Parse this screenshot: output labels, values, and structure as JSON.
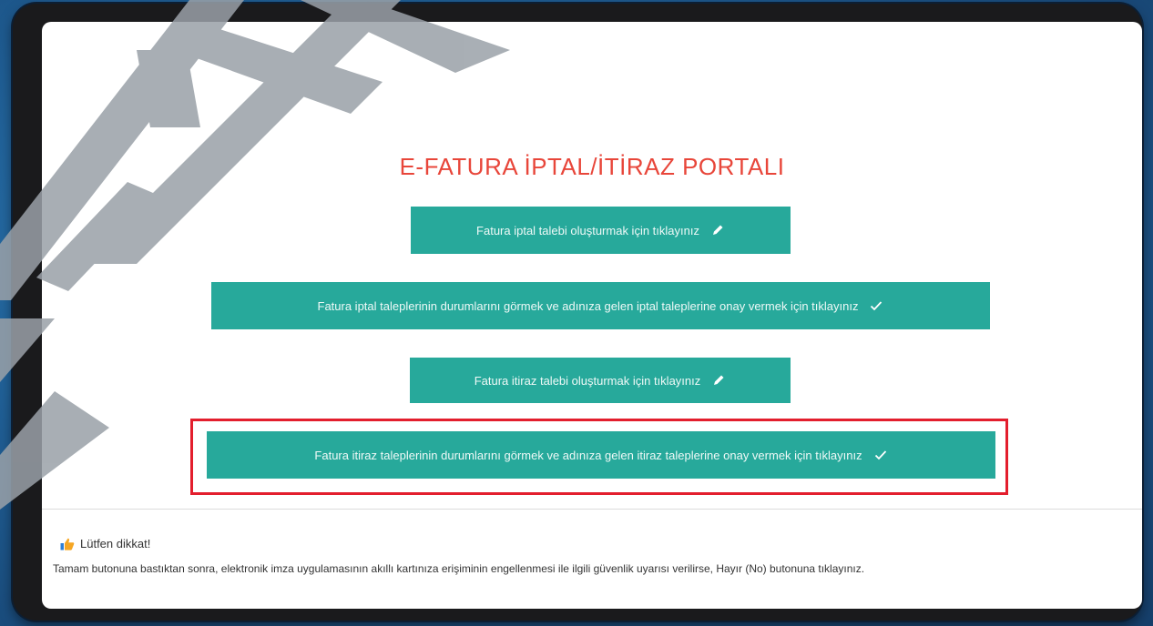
{
  "portal": {
    "title": "E-FATURA İPTAL/İTİRAZ PORTALI",
    "buttons": [
      {
        "label": "Fatura iptal talebi oluşturmak için tıklayınız",
        "icon": "pencil-icon"
      },
      {
        "label": "Fatura iptal taleplerinin durumlarını görmek ve adınıza gelen iptal taleplerine onay vermek için tıklayınız",
        "icon": "check-icon"
      },
      {
        "label": "Fatura itiraz talebi oluşturmak için tıklayınız",
        "icon": "pencil-icon"
      },
      {
        "label": "Fatura itiraz taleplerinin durumlarını görmek ve adınıza gelen itiraz taleplerine onay vermek için tıklayınız",
        "icon": "check-icon"
      }
    ]
  },
  "notice": {
    "title": "Lütfen dikkat!",
    "icon": "thumbs-up-icon",
    "text": "Tamam butonuna bastıktan sonra, elektronik imza uygulamasının akıllı kartınıza erişiminin engellenmesi ile ilgili güvenlik uyarısı verilirse, Hayır (No) butonuna tıklayınız."
  },
  "colors": {
    "title": "#e8463a",
    "button": "#27a99b",
    "highlight": "#e31e2d"
  }
}
